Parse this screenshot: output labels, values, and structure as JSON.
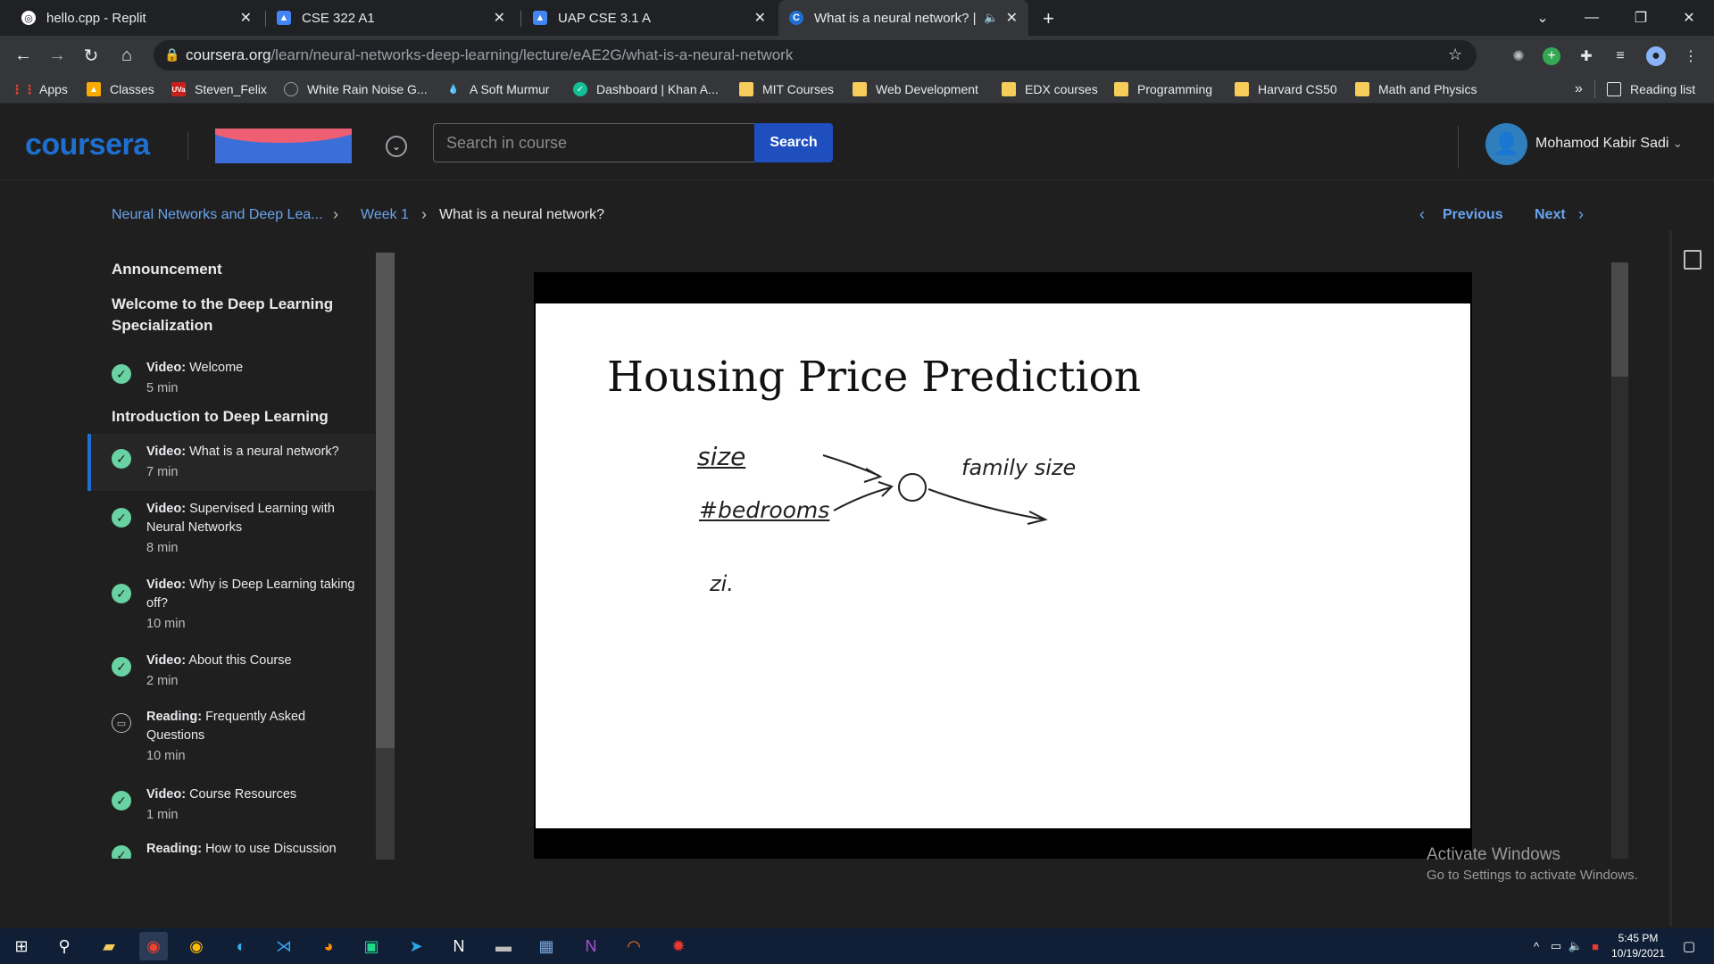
{
  "browser": {
    "tabs": [
      {
        "title": "hello.cpp - Replit",
        "icon": "replit-icon"
      },
      {
        "title": "CSE 322 A1",
        "icon": "classroom-icon"
      },
      {
        "title": "UAP CSE 3.1 A",
        "icon": "classroom-icon"
      },
      {
        "title": "What is a neural network? | C",
        "icon": "coursera-icon",
        "active": true
      }
    ],
    "url_host": "coursera.org",
    "url_path": "/learn/neural-networks-deep-learning/lecture/eAE2G/what-is-a-neural-network",
    "bookmarks": [
      {
        "label": "Apps"
      },
      {
        "label": "Classes"
      },
      {
        "label": "Steven_Felix"
      },
      {
        "label": "White Rain Noise G..."
      },
      {
        "label": "A Soft Murmur"
      },
      {
        "label": "Dashboard | Khan A..."
      },
      {
        "label": "MIT Courses"
      },
      {
        "label": "Web Development"
      },
      {
        "label": "EDX courses"
      },
      {
        "label": "Programming"
      },
      {
        "label": "Harvard CS50"
      },
      {
        "label": "Math and Physics"
      }
    ],
    "bookmarks_overflow": "»",
    "reading_list": "Reading list"
  },
  "header": {
    "logo": "coursera",
    "search_placeholder": "Search in course",
    "search_button": "Search",
    "user_name": "Mohamod Kabir Sadi"
  },
  "breadcrumb": {
    "course": "Neural Networks and Deep Lea...",
    "week": "Week 1",
    "current": "What is a neural network?"
  },
  "pager": {
    "previous": "Previous",
    "next": "Next"
  },
  "sidebar": {
    "announcement": "Announcement",
    "section1": "Welcome to the Deep Learning Specialization",
    "section2": "Introduction to Deep Learning",
    "items": [
      {
        "kind": "Video:",
        "title": "Welcome",
        "duration": "5 min",
        "status": "done"
      },
      {
        "kind": "Video:",
        "title": "What is a neural network?",
        "duration": "7 min",
        "status": "done"
      },
      {
        "kind": "Video:",
        "title": "Supervised Learning with Neural Networks",
        "duration": "8 min",
        "status": "done"
      },
      {
        "kind": "Video:",
        "title": "Why is Deep Learning taking off?",
        "duration": "10 min",
        "status": "done"
      },
      {
        "kind": "Video:",
        "title": "About this Course",
        "duration": "2 min",
        "status": "done"
      },
      {
        "kind": "Reading:",
        "title": "Frequently Asked Questions",
        "duration": "10 min",
        "status": "reading"
      },
      {
        "kind": "Video:",
        "title": "Course Resources",
        "duration": "1 min",
        "status": "done"
      },
      {
        "kind": "Reading:",
        "title": "How to use Discussion",
        "duration": "",
        "status": "done"
      }
    ]
  },
  "slide": {
    "title": "Housing Price Prediction",
    "handwriting": {
      "input1": "size",
      "input2": "#bedrooms",
      "output": "family size",
      "note": "zi."
    }
  },
  "watermark": {
    "line1": "Activate Windows",
    "line2": "Go to Settings to activate Windows."
  },
  "taskbar": {
    "time": "5:45 PM",
    "date": "10/19/2021"
  }
}
